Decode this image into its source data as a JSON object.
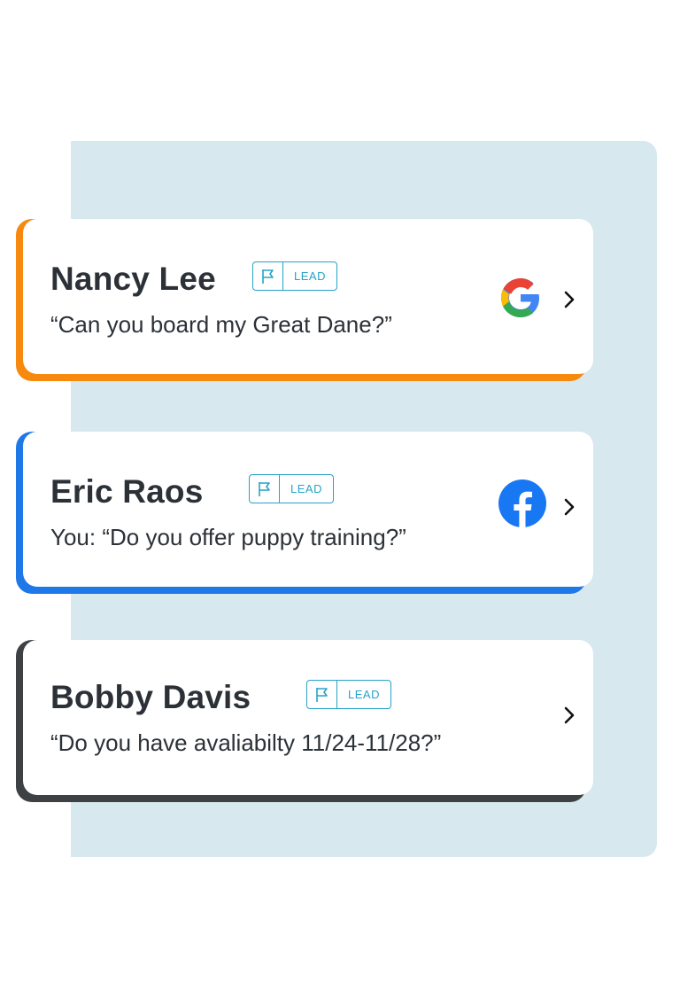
{
  "leads": [
    {
      "name": "Nancy Lee",
      "badge": "LEAD",
      "message": "“Can you board my Great Dane?”",
      "source": "google-icon",
      "accent": "#f7890f"
    },
    {
      "name": "Eric Raos",
      "badge": "LEAD",
      "message": "You: “Do you offer puppy training?”",
      "source": "facebook-icon",
      "accent": "#1f78e8"
    },
    {
      "name": "Bobby Davis",
      "badge": "LEAD",
      "message": "“Do you have avaliabilty 11/24-11/28?”",
      "source": null,
      "accent": "#3d4144"
    }
  ],
  "colors": {
    "panel_bg": "#d7e8ee",
    "badge": "#27a3c7",
    "text": "#2b3137",
    "facebook": "#1877f2"
  }
}
